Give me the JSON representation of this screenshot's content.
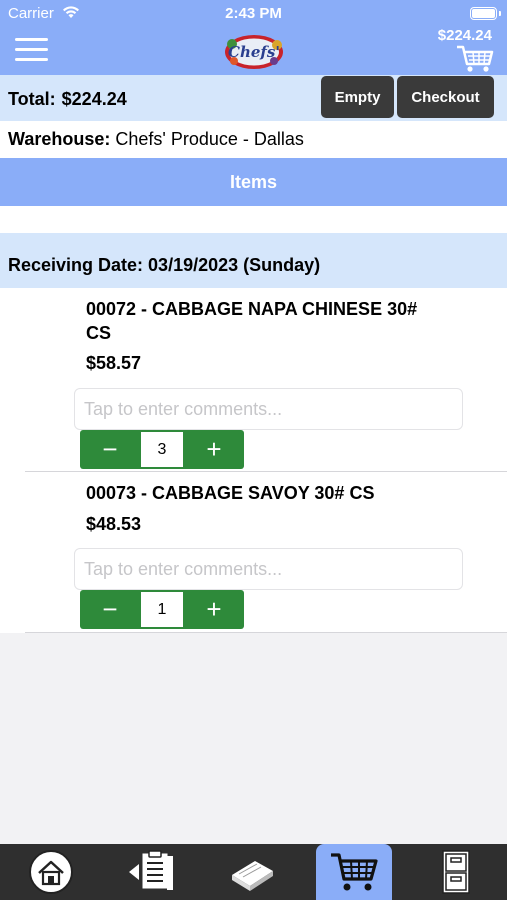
{
  "status_bar": {
    "carrier": "Carrier",
    "time": "2:43 PM"
  },
  "header": {
    "cart_total": "$224.24",
    "logo_text": "Chefs'"
  },
  "total_bar": {
    "label": "Total:",
    "amount": "$224.24",
    "empty_label": "Empty",
    "checkout_label": "Checkout"
  },
  "warehouse": {
    "label": "Warehouse:",
    "value": "Chefs' Produce - Dallas"
  },
  "items_header": "Items",
  "receiving_date": "Receiving Date: 03/19/2023 (Sunday)",
  "items": [
    {
      "name": "00072 - CABBAGE NAPA CHINESE 30# CS",
      "price": "$58.57",
      "comment_placeholder": "Tap to enter comments...",
      "quantity": "3"
    },
    {
      "name": "00073 - CABBAGE SAVOY 30# CS",
      "price": "$48.53",
      "comment_placeholder": "Tap to enter comments...",
      "quantity": "1"
    }
  ],
  "stepper": {
    "minus": "−",
    "plus": "+"
  },
  "tabbar": [
    {
      "icon": "home-icon",
      "active": false
    },
    {
      "icon": "order-list-icon",
      "active": false
    },
    {
      "icon": "catalog-book-icon",
      "active": false
    },
    {
      "icon": "cart-icon",
      "active": true
    },
    {
      "icon": "filing-cabinet-icon",
      "active": false
    }
  ],
  "colors": {
    "header": "#8aadf8",
    "light_bar": "#d5e6fb",
    "dark_button": "#3a3a3a",
    "stepper_green": "#2e8a3a",
    "tabbar": "#2f2f2f"
  }
}
